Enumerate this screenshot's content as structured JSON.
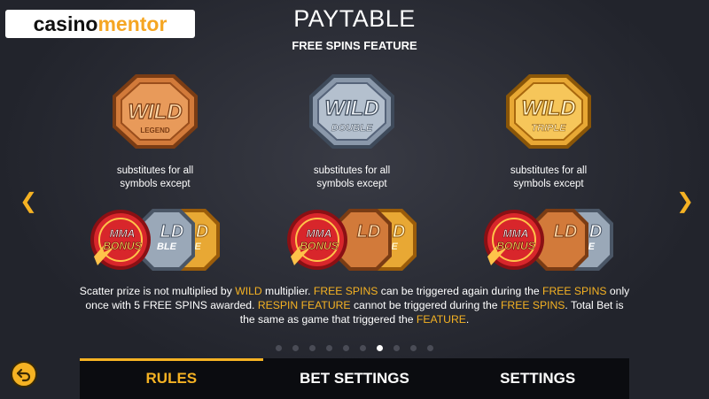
{
  "watermark": {
    "part_a": "casino",
    "part_b": "mentor"
  },
  "header": {
    "title": "PAYTABLE",
    "subtitle": "FREE SPINS FEATURE"
  },
  "columns": [
    {
      "badge_word": "WILD",
      "badge_sub": "LEGEND",
      "badge_color": "#d27a3a",
      "desc_line1": "substitutes for all",
      "desc_line2": "symbols except"
    },
    {
      "badge_word": "WILD",
      "badge_sub": "DOUBLE",
      "badge_color": "#9aa8b8",
      "desc_line1": "substitutes for all",
      "desc_line2": "symbols except"
    },
    {
      "badge_word": "WILD",
      "badge_sub": "TRIPLE",
      "badge_color": "#e8a834",
      "desc_line1": "substitutes for all",
      "desc_line2": "symbols except"
    }
  ],
  "bonus_text": "MMA BONUS",
  "bonus_top": "MMA",
  "bonus_bottom": "BONUS",
  "card_labels": {
    "ld": "LD",
    "ble": "BLE",
    "ple": "PLE"
  },
  "paragraph": {
    "s1": "Scatter prize is not multiplied by ",
    "s2": "WILD",
    "s3": " multiplier. ",
    "s4": "FREE SPINS",
    "s5": " can be triggered again during the ",
    "s6": "FREE SPINS",
    "s7": " only once with 5 FREE SPINS awarded. ",
    "s8": "RESPIN FEATURE",
    "s9": " cannot be triggered during the ",
    "s10": "FREE SPINS",
    "s11": ". Total Bet is the same as game that triggered the ",
    "s12": "FEATURE",
    "s13": "."
  },
  "pagination": {
    "total": 10,
    "active_index": 6
  },
  "tabs": [
    {
      "label": "RULES",
      "active": true
    },
    {
      "label": "BET SETTINGS",
      "active": false
    },
    {
      "label": "SETTINGS",
      "active": false
    }
  ],
  "nav": {
    "left_icon": "chevron-left-icon",
    "right_icon": "chevron-right-icon",
    "back_icon": "back-arrow-icon"
  },
  "colors": {
    "accent": "#f5b223",
    "background": "#1b1d24",
    "tab_bar": "#0b0c10",
    "bonus_red": "#d8262b"
  }
}
